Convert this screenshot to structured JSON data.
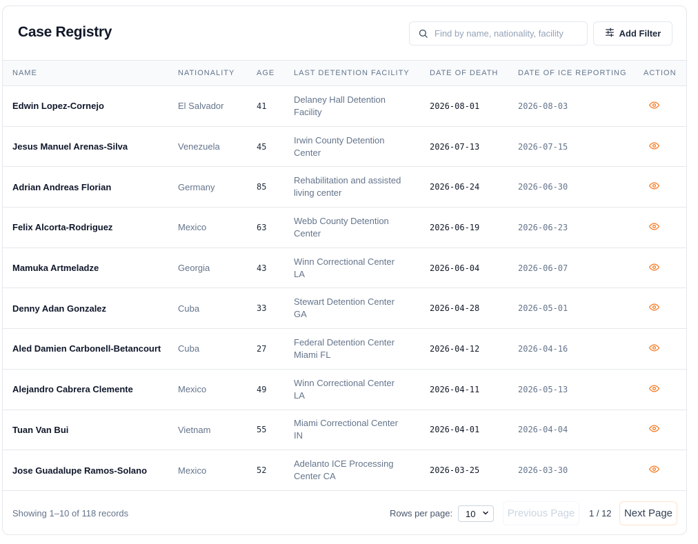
{
  "header": {
    "title": "Case Registry",
    "search_placeholder": "Find by name, nationality, facility",
    "add_filter_label": "Add Filter"
  },
  "columns": {
    "name": "NAME",
    "nationality": "NATIONALITY",
    "age": "AGE",
    "facility": "LAST DETENTION FACILITY",
    "date_of_death": "DATE OF DEATH",
    "date_ice": "DATE OF ICE REPORTING",
    "action": "ACTION"
  },
  "rows": [
    {
      "name": "Edwin Lopez-Cornejo",
      "nationality": "El Salvador",
      "age": "41",
      "facility": "Delaney Hall Detention Facility",
      "dod": "2026-08-01",
      "ice": "2026-08-03"
    },
    {
      "name": "Jesus Manuel Arenas-Silva",
      "nationality": "Venezuela",
      "age": "45",
      "facility": "Irwin County Detention Center",
      "dod": "2026-07-13",
      "ice": "2026-07-15"
    },
    {
      "name": "Adrian Andreas Florian",
      "nationality": "Germany",
      "age": "85",
      "facility": "Rehabilitation and assisted living center",
      "dod": "2026-06-24",
      "ice": "2026-06-30"
    },
    {
      "name": "Felix Alcorta-Rodriguez",
      "nationality": "Mexico",
      "age": "63",
      "facility": "Webb County Detention Center",
      "dod": "2026-06-19",
      "ice": "2026-06-23"
    },
    {
      "name": "Mamuka Artmeladze",
      "nationality": "Georgia",
      "age": "43",
      "facility": "Winn Correctional Center LA",
      "dod": "2026-06-04",
      "ice": "2026-06-07"
    },
    {
      "name": "Denny Adan Gonzalez",
      "nationality": "Cuba",
      "age": "33",
      "facility": "Stewart Detention Center GA",
      "dod": "2026-04-28",
      "ice": "2026-05-01"
    },
    {
      "name": "Aled Damien Carbonell-Betancourt",
      "nationality": "Cuba",
      "age": "27",
      "facility": "Federal Detention Center Miami FL",
      "dod": "2026-04-12",
      "ice": "2026-04-16"
    },
    {
      "name": "Alejandro Cabrera Clemente",
      "nationality": "Mexico",
      "age": "49",
      "facility": "Winn Correctional Center LA",
      "dod": "2026-04-11",
      "ice": "2026-05-13"
    },
    {
      "name": "Tuan Van Bui",
      "nationality": "Vietnam",
      "age": "55",
      "facility": "Miami Correctional Center IN",
      "dod": "2026-04-01",
      "ice": "2026-04-04"
    },
    {
      "name": "Jose Guadalupe Ramos-Solano",
      "nationality": "Mexico",
      "age": "52",
      "facility": "Adelanto ICE Processing Center CA",
      "dod": "2026-03-25",
      "ice": "2026-03-30"
    }
  ],
  "row_action_icon": "eye-icon",
  "footer": {
    "records_text": "Showing 1–10 of 118 records",
    "rows_per_page_label": "Rows per page:",
    "rows_per_page_value": "10",
    "prev_label": "Previous Page",
    "page_info": "1 / 12",
    "next_label": "Next Page"
  },
  "colors": {
    "accent": "#f97316",
    "text_primary": "#0f172a",
    "text_muted": "#64748b",
    "border": "#e5e7eb",
    "header_bg": "#f8fafc"
  }
}
